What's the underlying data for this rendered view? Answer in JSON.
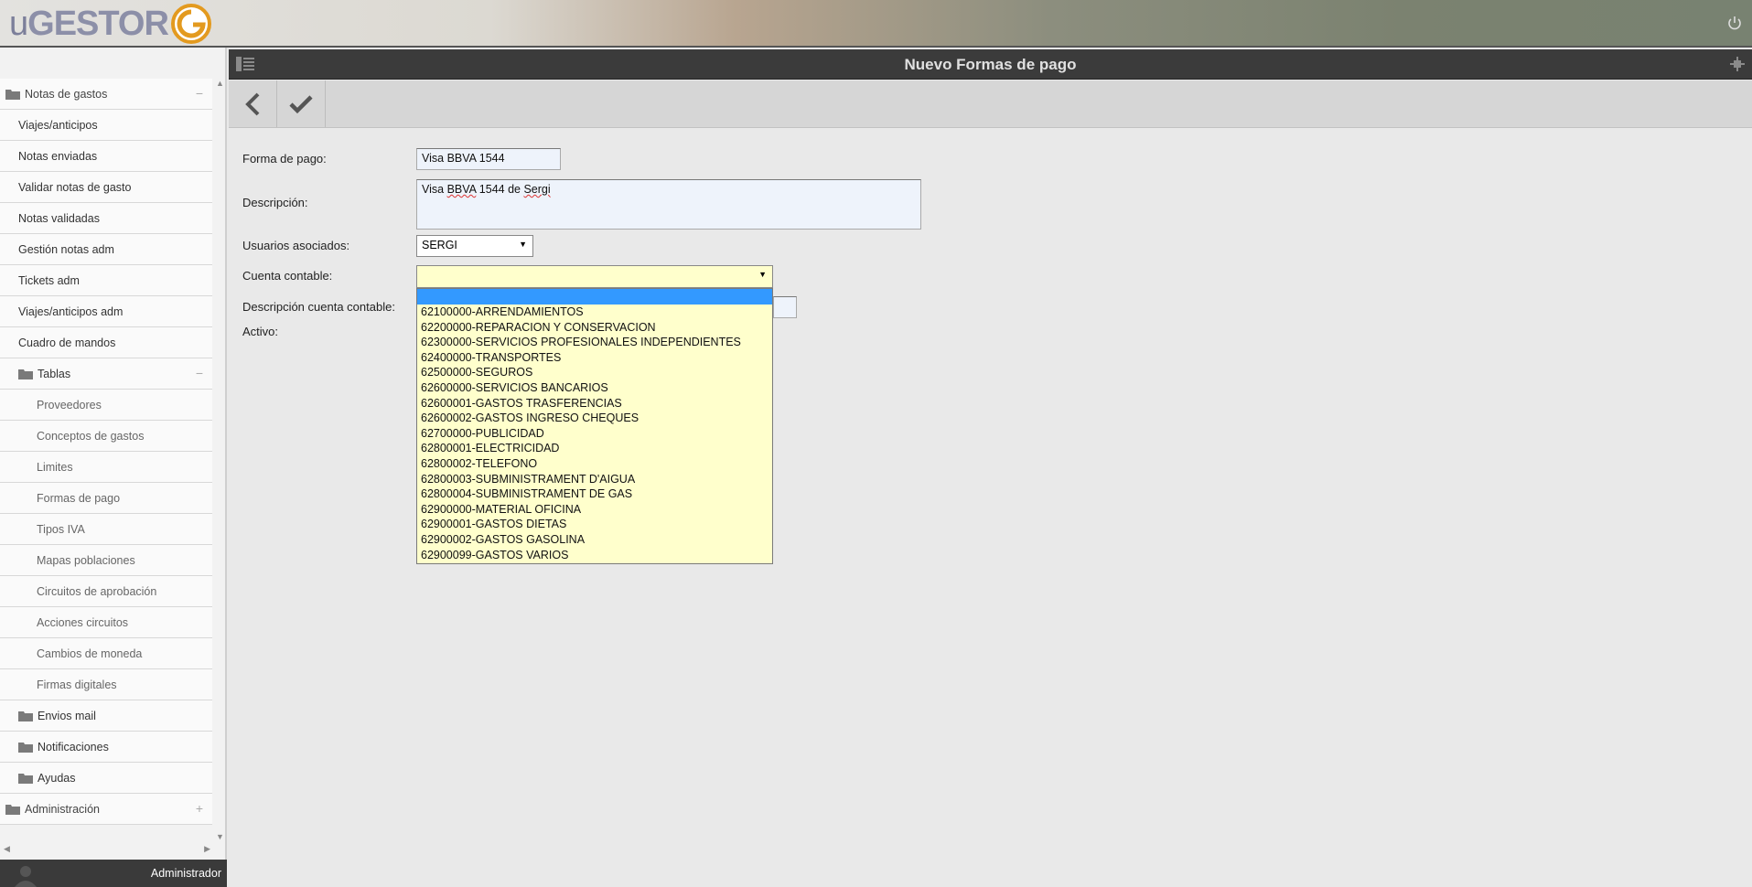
{
  "logo": {
    "u": "u",
    "rest": "GESTOR"
  },
  "page": {
    "title": "Nuevo Formas de pago"
  },
  "sidebar": {
    "items": [
      {
        "label": "Notas de gastos",
        "level": 0,
        "folder": true,
        "toggle": "−"
      },
      {
        "label": "Viajes/anticipos",
        "level": 1
      },
      {
        "label": "Notas enviadas",
        "level": 1
      },
      {
        "label": "Validar notas de gasto",
        "level": 1
      },
      {
        "label": "Notas validadas",
        "level": 1
      },
      {
        "label": "Gestión notas adm",
        "level": 1
      },
      {
        "label": "Tickets adm",
        "level": 1
      },
      {
        "label": "Viajes/anticipos adm",
        "level": 1
      },
      {
        "label": "Cuadro de mandos",
        "level": 1
      },
      {
        "label": "Tablas",
        "level": 1,
        "folder": true,
        "toggle": "−"
      },
      {
        "label": "Proveedores",
        "level": 2
      },
      {
        "label": "Conceptos de gastos",
        "level": 2
      },
      {
        "label": "Limites",
        "level": 2
      },
      {
        "label": "Formas de pago",
        "level": 2
      },
      {
        "label": "Tipos IVA",
        "level": 2
      },
      {
        "label": "Mapas poblaciones",
        "level": 2
      },
      {
        "label": "Circuitos de aprobación",
        "level": 2
      },
      {
        "label": "Acciones circuitos",
        "level": 2
      },
      {
        "label": "Cambios de moneda",
        "level": 2
      },
      {
        "label": "Firmas digitales",
        "level": 2
      },
      {
        "label": "Envios mail",
        "level": 1,
        "folder": true
      },
      {
        "label": "Notificaciones",
        "level": 1,
        "folder": true
      },
      {
        "label": "Ayudas",
        "level": 1,
        "folder": true
      },
      {
        "label": "Administración",
        "level": 0,
        "folder": true,
        "toggle": "+"
      }
    ]
  },
  "user": {
    "name": "Administrador"
  },
  "form": {
    "forma_pago": {
      "label": "Forma de pago:",
      "value": "Visa BBVA 1544"
    },
    "descripcion": {
      "label": "Descripción:",
      "value_pre": "Visa ",
      "value_bbva": "BBVA",
      "value_mid": " 1544 de ",
      "value_sergi": "Sergi"
    },
    "usuarios": {
      "label": "Usuarios asociados:",
      "value": "SERGI"
    },
    "cuenta": {
      "label": "Cuenta contable:",
      "value": ""
    },
    "desc_cuenta": {
      "label": "Descripción cuenta contable:"
    },
    "activo": {
      "label": "Activo:"
    }
  },
  "dropdown": {
    "options": [
      "62100000-ARRENDAMIENTOS",
      "62200000-REPARACION Y CONSERVACION",
      "62300000-SERVICIOS PROFESIONALES INDEPENDIENTES",
      "62400000-TRANSPORTES",
      "62500000-SEGUROS",
      "62600000-SERVICIOS BANCARIOS",
      "62600001-GASTOS TRASFERENCIAS",
      "62600002-GASTOS INGRESO CHEQUES",
      "62700000-PUBLICIDAD",
      "62800001-ELECTRICIDAD",
      "62800002-TELEFONO",
      "62800003-SUBMINISTRAMENT D'AIGUA",
      "62800004-SUBMINISTRAMENT DE GAS",
      "62900000-MATERIAL OFICINA",
      "62900001-GASTOS DIETAS",
      "62900002-GASTOS GASOLINA",
      "62900099-GASTOS VARIOS"
    ]
  },
  "colors": {
    "accent_orange": "#e39a1f",
    "selection_blue": "#3399ff",
    "dropdown_bg": "#ffffcc"
  }
}
